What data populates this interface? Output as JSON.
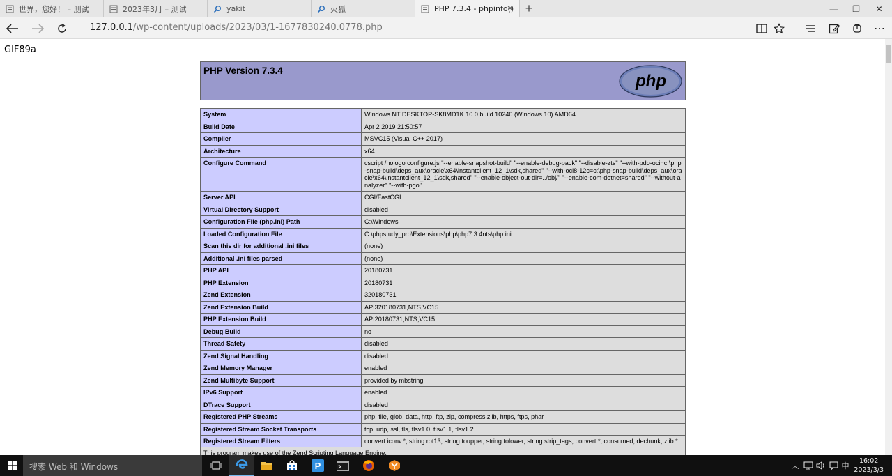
{
  "browser": {
    "tabs": [
      {
        "title": "世界，您好！ – 测试",
        "icon": "wordpress-icon"
      },
      {
        "title": "2023年3月 – 测试",
        "icon": "page-icon"
      },
      {
        "title": "yakit",
        "icon": "search-icon"
      },
      {
        "title": "火狐",
        "icon": "search-icon"
      },
      {
        "title": "PHP 7.3.4 - phpinfo()",
        "icon": "page-icon",
        "active": true
      }
    ],
    "new_tab": "+",
    "window_controls": {
      "minimize": "—",
      "maximize": "❐",
      "close": "✕"
    },
    "url_host": "127.0.0.1",
    "url_path": "/wp-content/uploads/2023/03/1-1677830240.0778.php"
  },
  "page": {
    "gif_text": "GIF89a",
    "php_version": "PHP Version 7.3.4",
    "logo_text": "php",
    "rows": [
      {
        "k": "System",
        "v": "Windows NT DESKTOP-SK8MD1K 10.0 build 10240 (Windows 10) AMD64"
      },
      {
        "k": "Build Date",
        "v": "Apr 2 2019 21:50:57"
      },
      {
        "k": "Compiler",
        "v": "MSVC15 (Visual C++ 2017)"
      },
      {
        "k": "Architecture",
        "v": "x64"
      },
      {
        "k": "Configure Command",
        "v": "cscript /nologo configure.js \"--enable-snapshot-build\" \"--enable-debug-pack\" \"--disable-zts\" \"--with-pdo-oci=c:\\php-snap-build\\deps_aux\\oracle\\x64\\instantclient_12_1\\sdk,shared\" \"--with-oci8-12c=c:\\php-snap-build\\deps_aux\\oracle\\x64\\instantclient_12_1\\sdk,shared\" \"--enable-object-out-dir=../obj/\" \"--enable-com-dotnet=shared\" \"--without-analyzer\" \"--with-pgo\""
      },
      {
        "k": "Server API",
        "v": "CGI/FastCGI"
      },
      {
        "k": "Virtual Directory Support",
        "v": "disabled"
      },
      {
        "k": "Configuration File (php.ini) Path",
        "v": "C:\\Windows"
      },
      {
        "k": "Loaded Configuration File",
        "v": "C:\\phpstudy_pro\\Extensions\\php\\php7.3.4nts\\php.ini"
      },
      {
        "k": "Scan this dir for additional .ini files",
        "v": "(none)"
      },
      {
        "k": "Additional .ini files parsed",
        "v": "(none)"
      },
      {
        "k": "PHP API",
        "v": "20180731"
      },
      {
        "k": "PHP Extension",
        "v": "20180731"
      },
      {
        "k": "Zend Extension",
        "v": "320180731"
      },
      {
        "k": "Zend Extension Build",
        "v": "API320180731,NTS,VC15"
      },
      {
        "k": "PHP Extension Build",
        "v": "API20180731,NTS,VC15"
      },
      {
        "k": "Debug Build",
        "v": "no"
      },
      {
        "k": "Thread Safety",
        "v": "disabled"
      },
      {
        "k": "Zend Signal Handling",
        "v": "disabled"
      },
      {
        "k": "Zend Memory Manager",
        "v": "enabled"
      },
      {
        "k": "Zend Multibyte Support",
        "v": "provided by mbstring"
      },
      {
        "k": "IPv6 Support",
        "v": "enabled"
      },
      {
        "k": "DTrace Support",
        "v": "disabled"
      },
      {
        "k": "Registered PHP Streams",
        "v": "php, file, glob, data, http, ftp, zip, compress.zlib, https, ftps, phar"
      },
      {
        "k": "Registered Stream Socket Transports",
        "v": "tcp, udp, ssl, tls, tlsv1.0, tlsv1.1, tlsv1.2"
      },
      {
        "k": "Registered Stream Filters",
        "v": "convert.iconv.*, string.rot13, string.toupper, string.tolower, string.strip_tags, convert.*, consumed, dechunk, zlib.*"
      }
    ],
    "zend_text": "This program makes use of the Zend Scripting Language Engine:"
  },
  "taskbar": {
    "search_placeholder": "搜索 Web 和 Windows",
    "ime": "中",
    "time": "16:02",
    "date": "2023/3/3"
  }
}
